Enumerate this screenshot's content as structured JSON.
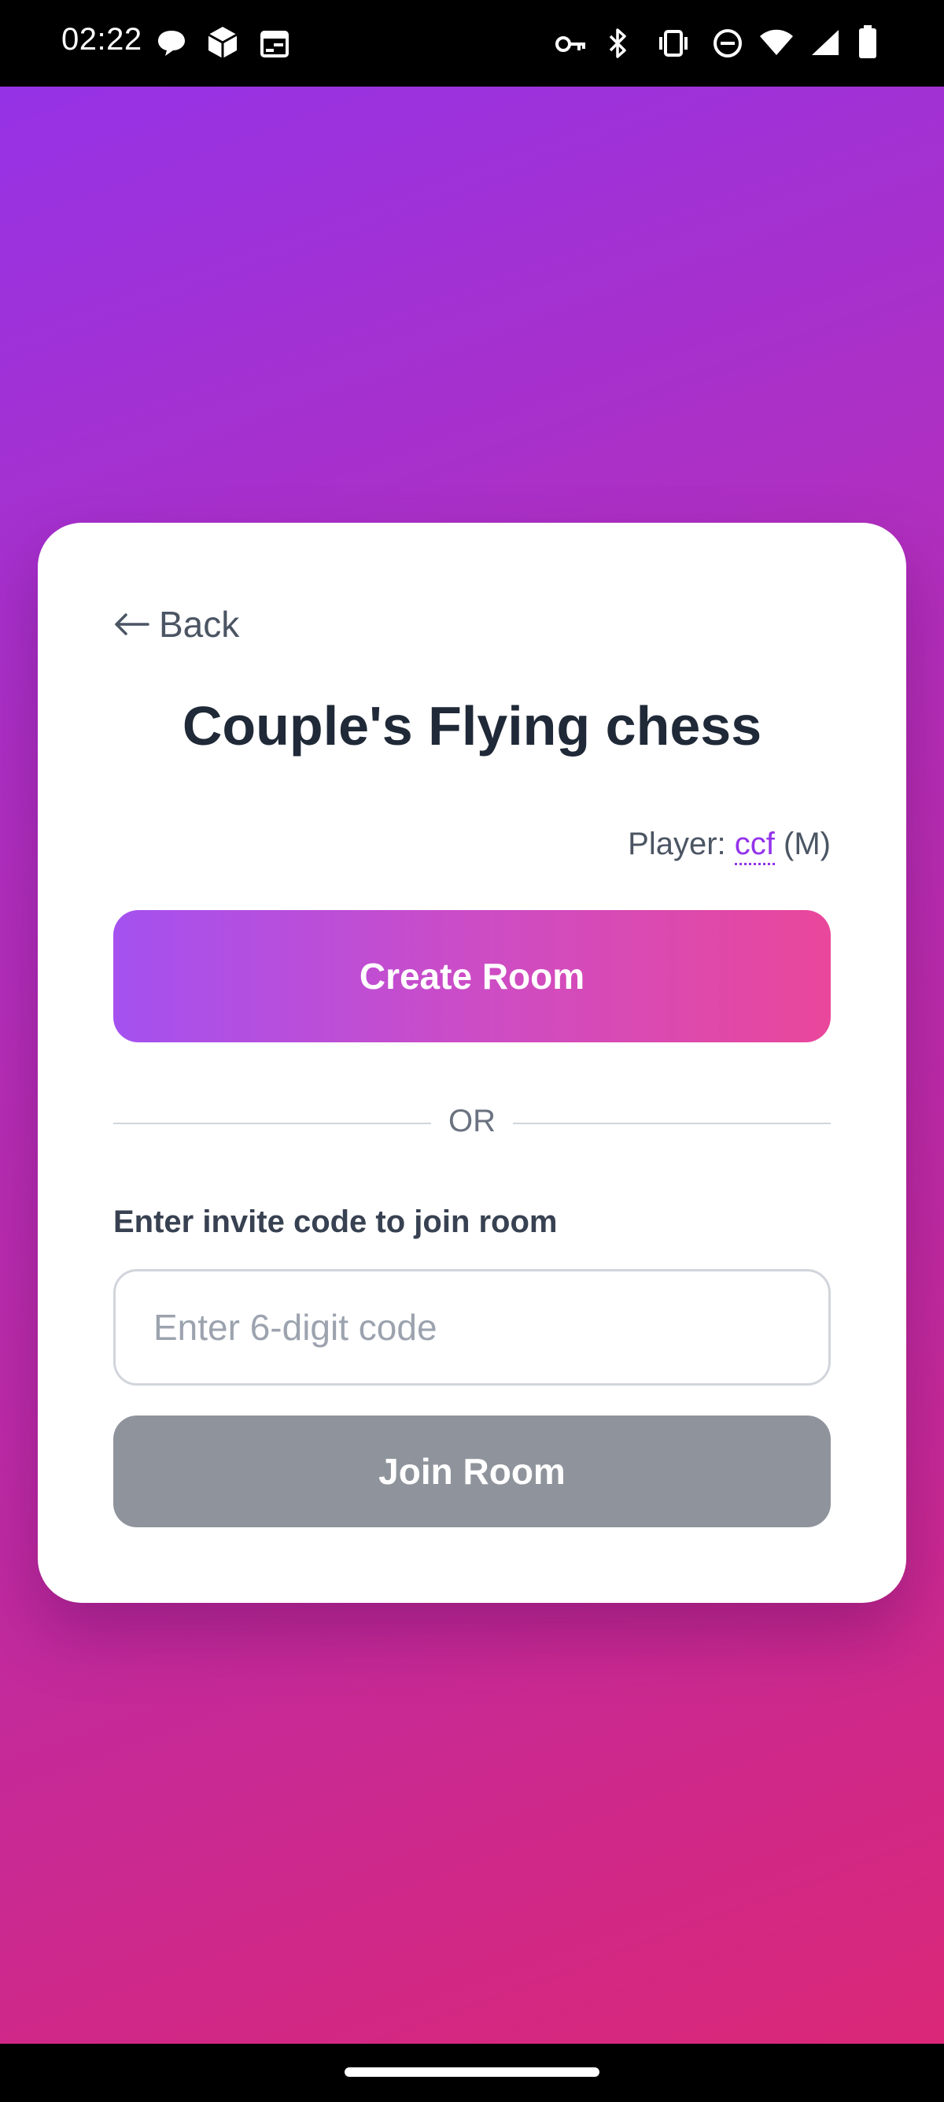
{
  "status_bar": {
    "time": "02:22",
    "left_icons": [
      "chat-bubble-icon",
      "cube-app-icon",
      "calendar-icon"
    ],
    "right_icons": [
      "vpn-key-icon",
      "bluetooth-icon",
      "vibrate-icon",
      "do-not-disturb-icon",
      "wifi-icon",
      "cellular-signal-icon",
      "battery-icon"
    ]
  },
  "card": {
    "back_label": "Back",
    "title": "Couple's Flying chess",
    "player": {
      "prefix": "Player:",
      "name": "ccf",
      "gender": "(M)"
    },
    "create_room_label": "Create Room",
    "divider_text": "OR",
    "join_label": "Enter invite code to join room",
    "code_input": {
      "value": "",
      "placeholder": "Enter 6-digit code"
    },
    "join_room_label": "Join Room"
  },
  "colors": {
    "background_start": "#9333ea",
    "background_end": "#dc2775",
    "create_button_start": "#a451f0",
    "create_button_end": "#e9479b",
    "join_button_disabled": "#8f949c",
    "accent": "#9333ea",
    "title": "#1f2937"
  }
}
